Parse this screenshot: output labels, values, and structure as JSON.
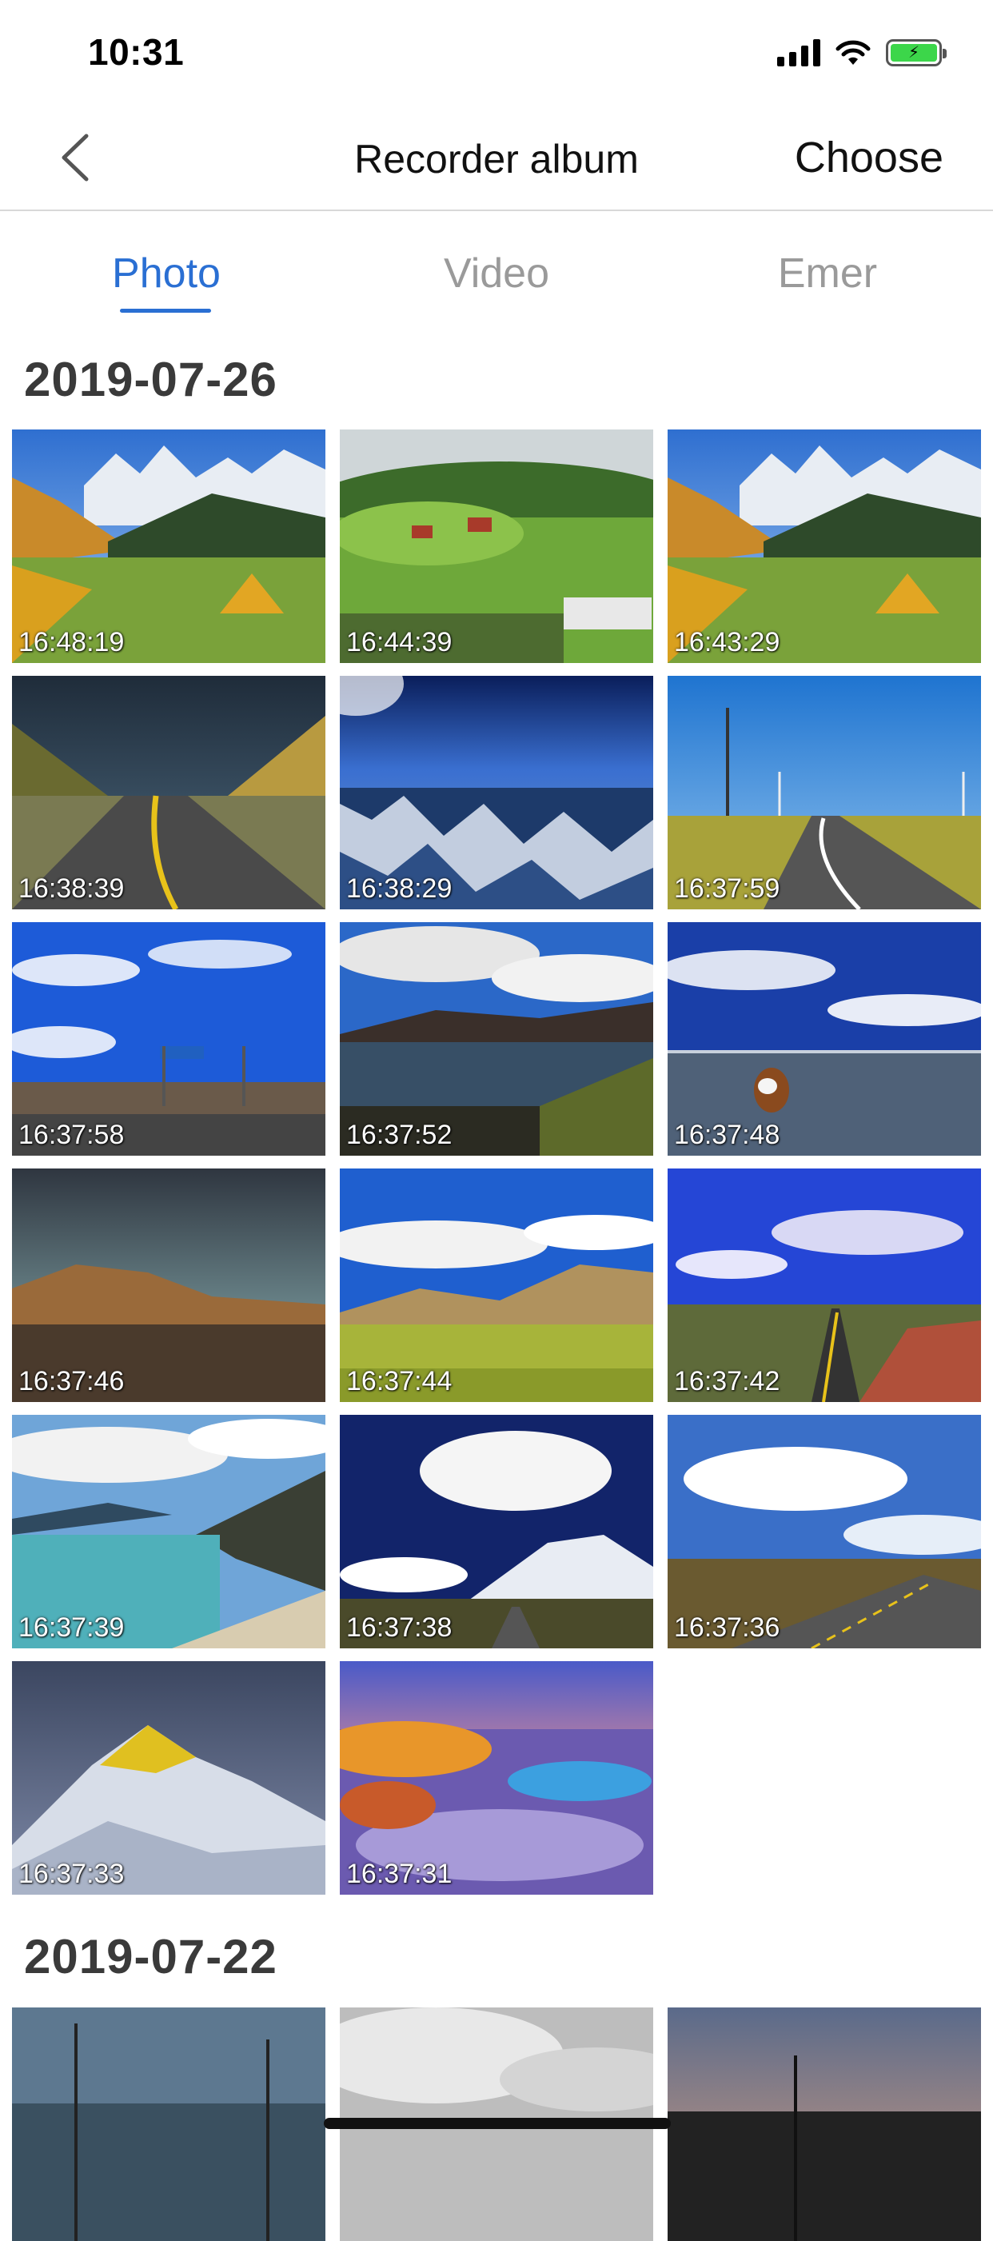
{
  "status_bar": {
    "time": "10:31"
  },
  "nav": {
    "title": "Recorder album",
    "choose_label": "Choose"
  },
  "tabs": [
    {
      "label": "Photo",
      "active": true
    },
    {
      "label": "Video",
      "active": false
    },
    {
      "label": "Emer",
      "active": false
    }
  ],
  "sections": [
    {
      "date": "2019-07-26",
      "photos": [
        {
          "time": "16:48:19",
          "scene": "mountain-meadow"
        },
        {
          "time": "16:44:39",
          "scene": "green-valley"
        },
        {
          "time": "16:43:29",
          "scene": "mountain-meadow"
        },
        {
          "time": "16:38:39",
          "scene": "stormy-road"
        },
        {
          "time": "16:38:29",
          "scene": "aerial-mountains"
        },
        {
          "time": "16:37:59",
          "scene": "windfarm-road"
        },
        {
          "time": "16:37:58",
          "scene": "blue-sky-gate"
        },
        {
          "time": "16:37:52",
          "scene": "lake-hills"
        },
        {
          "time": "16:37:48",
          "scene": "lake-yak"
        },
        {
          "time": "16:37:46",
          "scene": "desert-hills"
        },
        {
          "time": "16:37:44",
          "scene": "golden-plain"
        },
        {
          "time": "16:37:42",
          "scene": "blue-sky-road"
        },
        {
          "time": "16:37:39",
          "scene": "turquoise-lake"
        },
        {
          "time": "16:37:38",
          "scene": "cloud-mountain"
        },
        {
          "time": "16:37:36",
          "scene": "sky-highway"
        },
        {
          "time": "16:37:33",
          "scene": "snow-peak"
        },
        {
          "time": "16:37:31",
          "scene": "colorful-rocks"
        }
      ]
    },
    {
      "date": "2019-07-22",
      "photos": [
        {
          "time": "",
          "scene": "foggy-street"
        },
        {
          "time": "",
          "scene": "grey-clouds"
        },
        {
          "time": "",
          "scene": "dusk-street"
        }
      ]
    }
  ]
}
